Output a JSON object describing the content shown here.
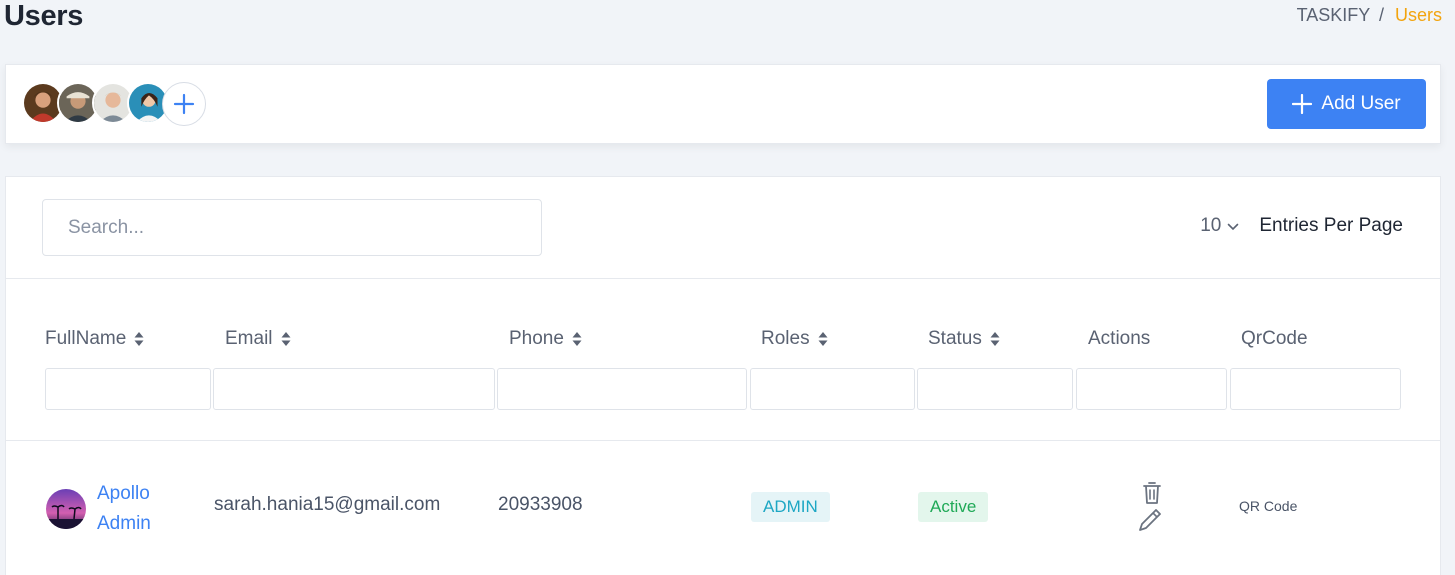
{
  "header": {
    "title": "Users",
    "breadcrumb": {
      "root": "TASKIFY",
      "separator": "/",
      "current": "Users"
    }
  },
  "toolbar": {
    "avatars": [
      "avatar-1",
      "avatar-2",
      "avatar-3",
      "avatar-4"
    ],
    "add_user_label": "Add User",
    "accent_color": "#3d82f3"
  },
  "table_controls": {
    "search_placeholder": "Search...",
    "entries_value": "10",
    "entries_label": "Entries Per Page"
  },
  "table": {
    "columns": [
      "FullName",
      "Email",
      "Phone",
      "Roles",
      "Status",
      "Actions",
      "QrCode"
    ],
    "rows": [
      {
        "first_name": "Apollo",
        "last_name": "Admin",
        "email": "sarah.hania15@gmail.com",
        "phone": "20933908",
        "role": "ADMIN",
        "status": "Active",
        "qr_label": "QR Code"
      }
    ]
  }
}
